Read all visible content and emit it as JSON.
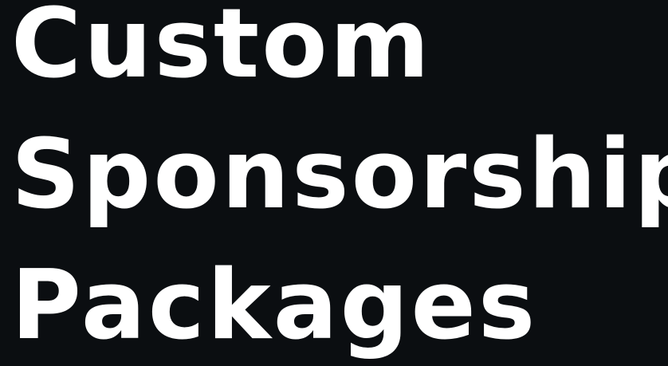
{
  "headline": {
    "lines": [
      "Custom",
      "Sponsorship",
      "Packages"
    ]
  },
  "colors": {
    "background": "#0b0e11",
    "text": "#ffffff"
  }
}
